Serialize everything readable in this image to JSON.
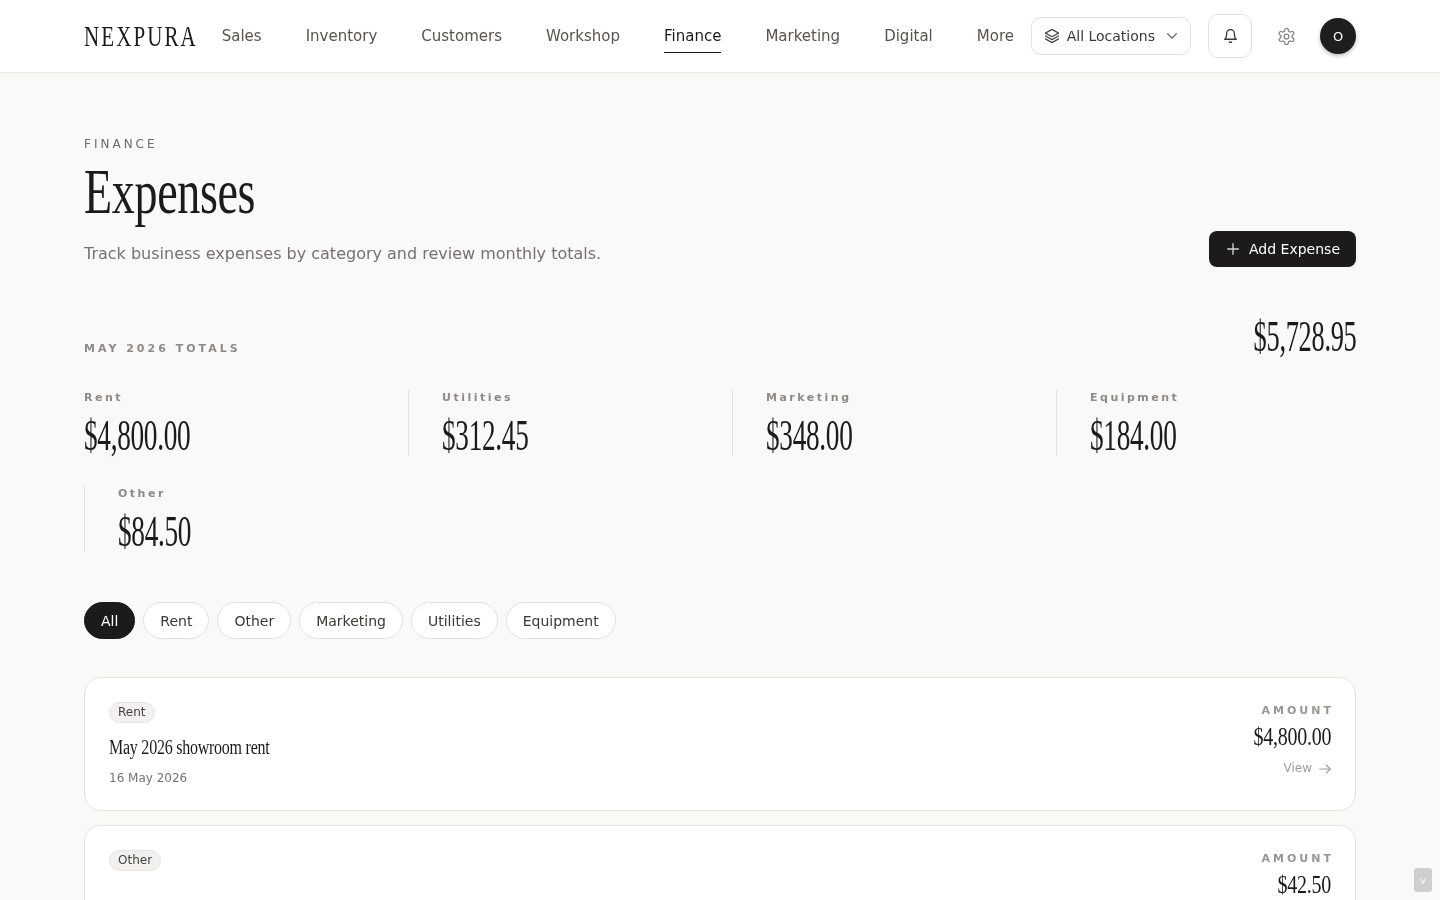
{
  "nav": {
    "logo": "NEXPURA",
    "items": [
      {
        "label": "Sales",
        "selected": false
      },
      {
        "label": "Inventory",
        "selected": false
      },
      {
        "label": "Customers",
        "selected": false
      },
      {
        "label": "Workshop",
        "selected": false
      },
      {
        "label": "Finance",
        "selected": true
      },
      {
        "label": "Marketing",
        "selected": false
      },
      {
        "label": "Digital",
        "selected": false
      },
      {
        "label": "More",
        "selected": false
      }
    ],
    "location_picker": {
      "label": "All Locations"
    },
    "avatar": {
      "initial": "O"
    }
  },
  "header": {
    "eyebrow": "FINANCE",
    "title": "Expenses",
    "subtitle": "Track business expenses by category and review monthly totals.",
    "add_button": {
      "label": "Add Expense"
    }
  },
  "totals": {
    "label": "MAY 2026 TOTALS",
    "total": "$5,728.95",
    "categories": [
      {
        "label": "Rent",
        "amount": "$4,800.00"
      },
      {
        "label": "Utilities",
        "amount": "$312.45"
      },
      {
        "label": "Marketing",
        "amount": "$348.00"
      },
      {
        "label": "Equipment",
        "amount": "$184.00"
      },
      {
        "label": "Other",
        "amount": "$84.50"
      }
    ]
  },
  "filters": [
    {
      "label": "All",
      "selected": true
    },
    {
      "label": "Rent",
      "selected": false
    },
    {
      "label": "Other",
      "selected": false
    },
    {
      "label": "Marketing",
      "selected": false
    },
    {
      "label": "Utilities",
      "selected": false
    },
    {
      "label": "Equipment",
      "selected": false
    }
  ],
  "expenses": [
    {
      "category": "Rent",
      "title": "May 2026 showroom rent",
      "date": "16 May 2026",
      "amount_label": "AMOUNT",
      "amount": "$4,800.00",
      "link": "View"
    },
    {
      "category": "Other",
      "amount_label": "AMOUNT",
      "amount": "$42.50"
    }
  ]
}
